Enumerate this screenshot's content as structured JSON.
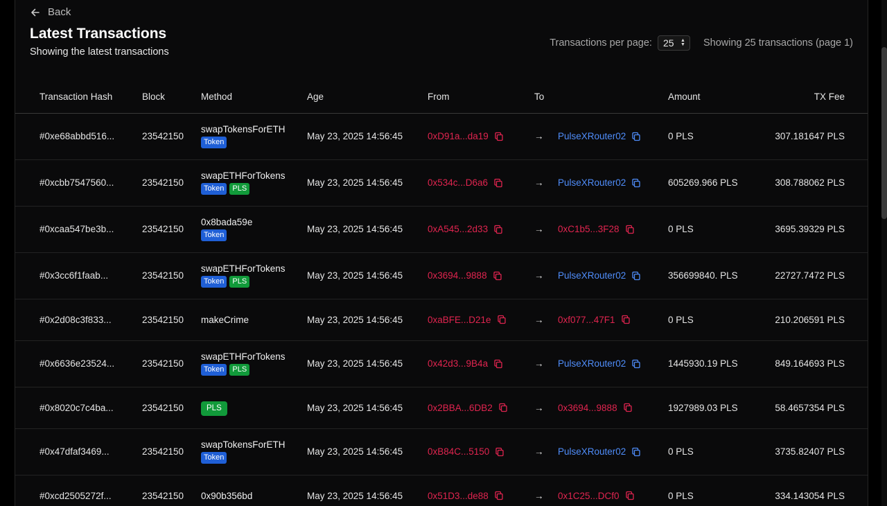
{
  "header": {
    "back_label": "Back",
    "title": "Latest Transactions",
    "subtitle": "Showing the latest transactions",
    "per_page_label": "Transactions per page:",
    "per_page_value": "25",
    "showing_text": "Showing 25 transactions (page 1)"
  },
  "columns": {
    "hash": "Transaction Hash",
    "block": "Block",
    "method": "Method",
    "age": "Age",
    "from": "From",
    "to": "To",
    "amount": "Amount",
    "fee": "TX Fee"
  },
  "rows": [
    {
      "hash": "#0xe68abbd516...",
      "block": "23542150",
      "method": "swapTokensForETH",
      "badges": [
        "Token"
      ],
      "age": "May 23, 2025 14:56:45",
      "from": "0xD91a...da19",
      "to": "PulseXRouter02",
      "to_color": "blue",
      "amount": "0 PLS",
      "fee": "307.181647 PLS"
    },
    {
      "hash": "#0xcbb7547560...",
      "block": "23542150",
      "method": "swapETHForTokens",
      "badges": [
        "Token",
        "PLS"
      ],
      "age": "May 23, 2025 14:56:45",
      "from": "0x534c...D6a6",
      "to": "PulseXRouter02",
      "to_color": "blue",
      "amount": "605269.966 PLS",
      "fee": "308.788062 PLS"
    },
    {
      "hash": "#0xcaa547be3b...",
      "block": "23542150",
      "method": "0x8bada59e",
      "badges": [
        "Token"
      ],
      "age": "May 23, 2025 14:56:45",
      "from": "0xA545...2d33",
      "to": "0xC1b5...3F28",
      "to_color": "red",
      "amount": "0 PLS",
      "fee": "3695.39329 PLS"
    },
    {
      "hash": "#0x3cc6f1faab...",
      "block": "23542150",
      "method": "swapETHForTokens",
      "badges": [
        "Token",
        "PLS"
      ],
      "age": "May 23, 2025 14:56:45",
      "from": "0x3694...9888",
      "to": "PulseXRouter02",
      "to_color": "blue",
      "amount": "356699840. PLS",
      "fee": "22727.7472 PLS"
    },
    {
      "hash": "#0x2d08c3f833...",
      "block": "23542150",
      "method": "makeCrime",
      "badges": [],
      "age": "May 23, 2025 14:56:45",
      "from": "0xaBFE...D21e",
      "to": "0xf077...47F1",
      "to_color": "red",
      "amount": "0 PLS",
      "fee": "210.206591 PLS"
    },
    {
      "hash": "#0x6636e23524...",
      "block": "23542150",
      "method": "swapETHForTokens",
      "badges": [
        "Token",
        "PLS"
      ],
      "age": "May 23, 2025 14:56:45",
      "from": "0x42d3...9B4a",
      "to": "PulseXRouter02",
      "to_color": "blue",
      "amount": "1445930.19 PLS",
      "fee": "849.164693 PLS"
    },
    {
      "hash": "#0x8020c7c4ba...",
      "block": "23542150",
      "method": "",
      "badges": [
        "PLS"
      ],
      "age": "May 23, 2025 14:56:45",
      "from": "0x2BBA...6DB2",
      "to": "0x3694...9888",
      "to_color": "red",
      "amount": "1927989.03 PLS",
      "fee": "58.4657354 PLS"
    },
    {
      "hash": "#0x47dfaf3469...",
      "block": "23542150",
      "method": "swapTokensForETH",
      "badges": [
        "Token"
      ],
      "age": "May 23, 2025 14:56:45",
      "from": "0xB84C...5150",
      "to": "PulseXRouter02",
      "to_color": "blue",
      "amount": "0 PLS",
      "fee": "3735.82407 PLS"
    },
    {
      "hash": "#0xcd2505272f...",
      "block": "23542150",
      "method": "0x90b356bd",
      "badges": [],
      "age": "May 23, 2025 14:56:45",
      "from": "0x51D3...de88",
      "to": "0x1C25...DCf0",
      "to_color": "red",
      "amount": "0 PLS",
      "fee": "334.143054 PLS"
    }
  ],
  "arrow_glyph": "→",
  "colors": {
    "from_address": "#e0244f",
    "to_contract": "#4f8dfa",
    "token_badge": "#1f5fd6",
    "pls_badge": "#119a3a"
  }
}
